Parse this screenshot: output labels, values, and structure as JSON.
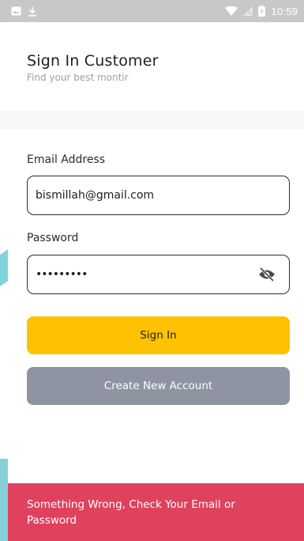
{
  "status_bar": {
    "time": "10:59",
    "left_icons": [
      "image-icon",
      "download-icon"
    ],
    "right_icons": [
      "wifi-icon",
      "no-signal-icon",
      "battery-charging-icon"
    ]
  },
  "header": {
    "title": "Sign In Customer",
    "subtitle": "Find your best montir"
  },
  "form": {
    "email_label": "Email Address",
    "email_value": "bismillah@gmail.com",
    "password_label": "Password",
    "password_value": "•••••••••",
    "password_toggle_icon": "eye-off-icon"
  },
  "buttons": {
    "sign_in": "Sign In",
    "create_account": "Create New Account"
  },
  "snackbar": {
    "message": "Something Wrong, Check Your Email or Password"
  },
  "colors": {
    "primary_button": "#FEC200",
    "secondary_button": "#8F94A3",
    "error_snackbar": "#E0415F",
    "status_bar": "#C8C8C8"
  }
}
